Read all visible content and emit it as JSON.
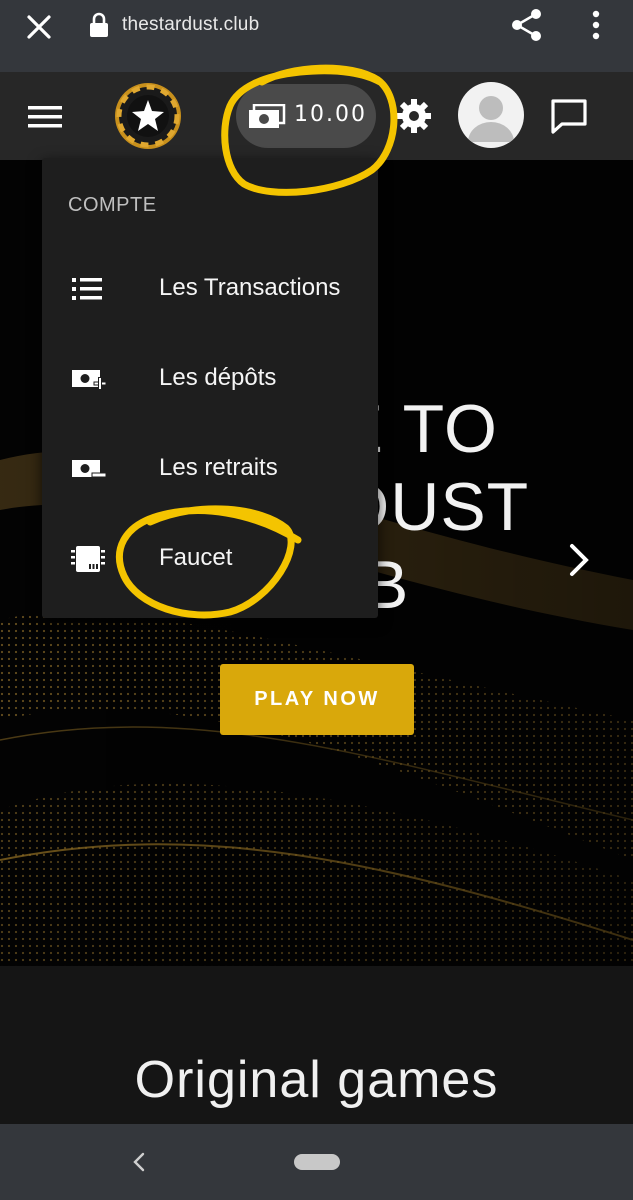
{
  "browser": {
    "url": "thestardust.club",
    "icons": [
      "close-icon",
      "lock-icon",
      "share-icon",
      "more-vert-icon"
    ]
  },
  "header": {
    "balance": "10.00",
    "icons": [
      "hamburger-icon",
      "logo",
      "money-icon",
      "gear-icon",
      "avatar",
      "chat-icon"
    ]
  },
  "menu": {
    "header": "COMPTE",
    "items": [
      {
        "label": "Les Transactions",
        "icon": "list-icon"
      },
      {
        "label": "Les dépôts",
        "icon": "money-plus-icon"
      },
      {
        "label": "Les retraits",
        "icon": "money-minus-icon"
      },
      {
        "label": "Faucet",
        "icon": "chip-icon"
      }
    ]
  },
  "hero": {
    "title_line1": "ME TO",
    "title_line2": "RDUST",
    "title_line3": "B",
    "cta": "PLAY NOW"
  },
  "games": {
    "title": "Original games"
  },
  "colors": {
    "accent": "#d9a80b",
    "annotation": "#f4c400",
    "header_bg": "#272727",
    "menu_bg": "#1e1e1e",
    "browser_bg": "#34373c"
  }
}
